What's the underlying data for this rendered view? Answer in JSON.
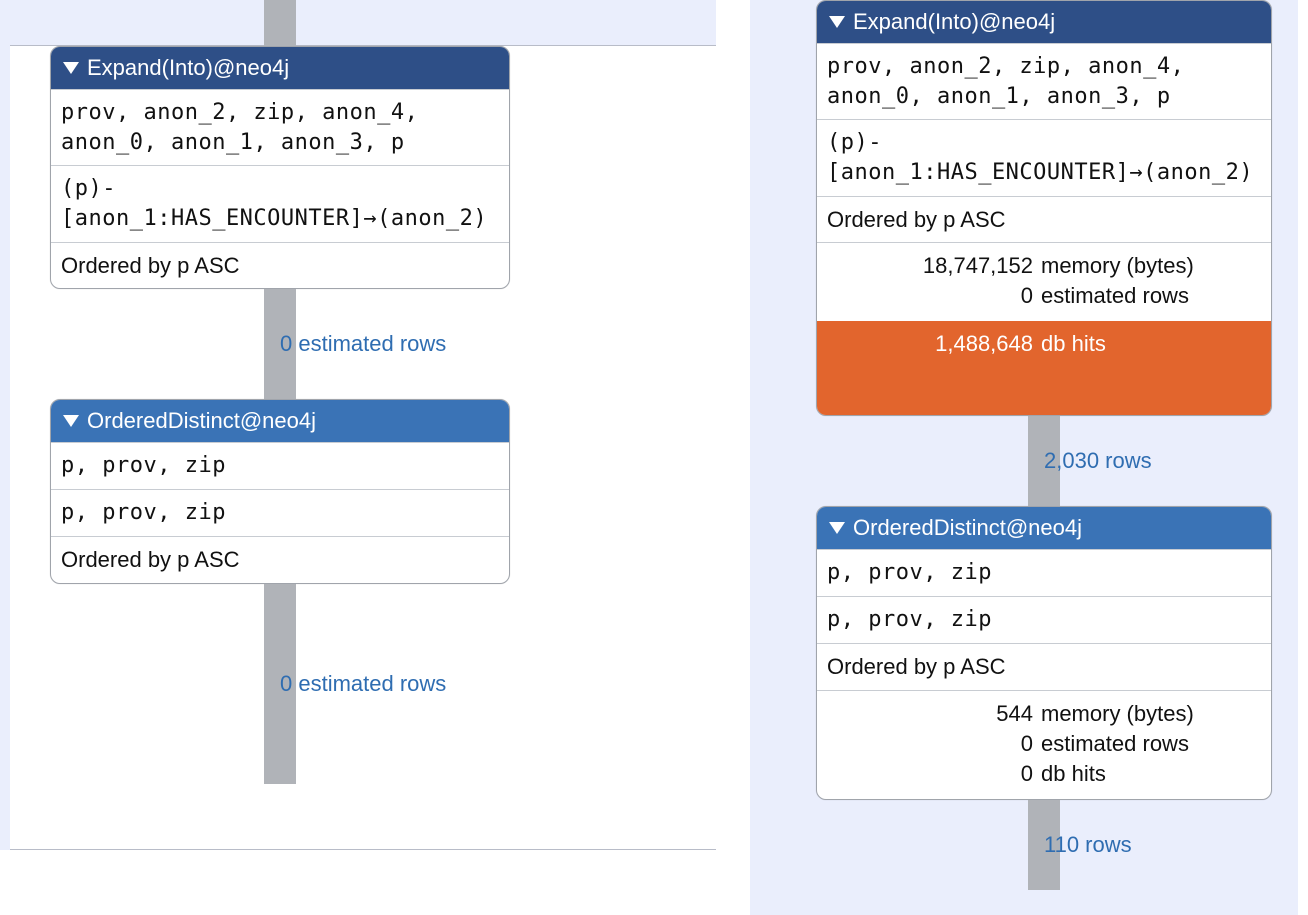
{
  "colors": {
    "header_dark": "#2e4f87",
    "header_mid": "#3a73b6",
    "hits_highlight": "#e2652d",
    "connector": "#b0b3b8",
    "label_blue": "#2f6db1",
    "panel_bg": "#eaeefc"
  },
  "left": {
    "initial_connector_height": 80,
    "nodes": [
      {
        "id": "expand-into-left",
        "header_style": "dark",
        "title": "Expand(Into)@neo4j",
        "rows": [
          {
            "mono": true,
            "text": "prov, anon_2, zip, anon_4, anon_0, anon_1, anon_3, p"
          },
          {
            "mono": true,
            "text": "(p)-[anon_1:HAS_ENCOUNTER]→(anon_2)"
          },
          {
            "mono": false,
            "text": "Ordered by p ASC"
          }
        ],
        "out_label": "0 estimated rows",
        "out_connector_height": 110
      },
      {
        "id": "ordered-distinct-left",
        "header_style": "mid",
        "title": "OrderedDistinct@neo4j",
        "rows": [
          {
            "mono": true,
            "text": "p, prov, zip"
          },
          {
            "mono": true,
            "text": "p, prov, zip"
          },
          {
            "mono": false,
            "text": "Ordered by p ASC"
          }
        ],
        "out_label": "0 estimated rows",
        "out_connector_height": 200
      }
    ]
  },
  "right": {
    "initial_connector_height": 56,
    "nodes": [
      {
        "id": "expand-into-right",
        "header_style": "dark",
        "title": "Expand(Into)@neo4j",
        "rows": [
          {
            "mono": true,
            "text": "prov, anon_2, zip, anon_4, anon_0, anon_1, anon_3, p"
          },
          {
            "mono": true,
            "text": "(p)-[anon_1:HAS_ENCOUNTER]→(anon_2)"
          },
          {
            "mono": false,
            "text": "Ordered by p ASC"
          }
        ],
        "stats": [
          {
            "num": "18,747,152",
            "label": "memory (bytes)"
          },
          {
            "num": "0",
            "label": "estimated rows"
          }
        ],
        "hits": {
          "num": "1,488,648",
          "label": "db hits"
        },
        "out_label": "2,030 rows",
        "out_connector_height": 90
      },
      {
        "id": "ordered-distinct-right",
        "header_style": "mid",
        "title": "OrderedDistinct@neo4j",
        "rows": [
          {
            "mono": true,
            "text": "p, prov, zip"
          },
          {
            "mono": true,
            "text": "p, prov, zip"
          },
          {
            "mono": false,
            "text": "Ordered by p ASC"
          }
        ],
        "stats": [
          {
            "num": "544",
            "label": "memory (bytes)"
          },
          {
            "num": "0",
            "label": "estimated rows"
          },
          {
            "num": "0",
            "label": "db hits"
          }
        ],
        "out_label": "110 rows",
        "out_connector_height": 90
      }
    ]
  }
}
